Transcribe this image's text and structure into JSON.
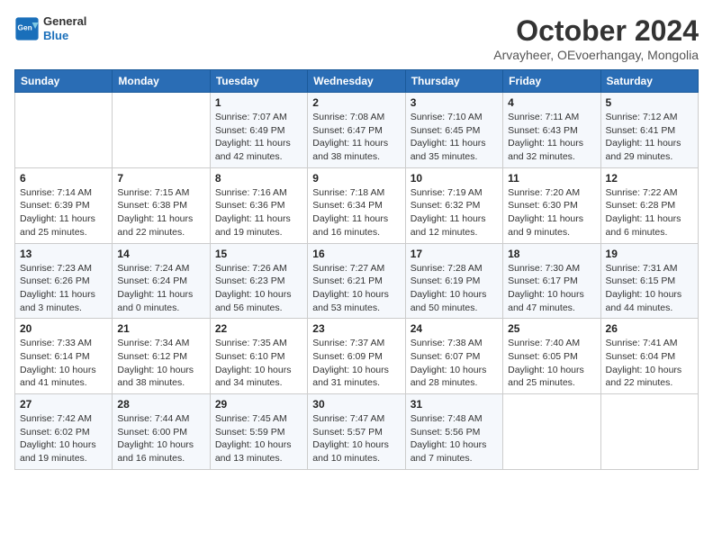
{
  "header": {
    "logo_line1": "General",
    "logo_line2": "Blue",
    "month": "October 2024",
    "location": "Arvayheer, OEvoerhangay, Mongolia"
  },
  "days_of_week": [
    "Sunday",
    "Monday",
    "Tuesday",
    "Wednesday",
    "Thursday",
    "Friday",
    "Saturday"
  ],
  "weeks": [
    [
      {
        "day": null
      },
      {
        "day": null
      },
      {
        "day": "1",
        "sunrise": "Sunrise: 7:07 AM",
        "sunset": "Sunset: 6:49 PM",
        "daylight": "Daylight: 11 hours and 42 minutes."
      },
      {
        "day": "2",
        "sunrise": "Sunrise: 7:08 AM",
        "sunset": "Sunset: 6:47 PM",
        "daylight": "Daylight: 11 hours and 38 minutes."
      },
      {
        "day": "3",
        "sunrise": "Sunrise: 7:10 AM",
        "sunset": "Sunset: 6:45 PM",
        "daylight": "Daylight: 11 hours and 35 minutes."
      },
      {
        "day": "4",
        "sunrise": "Sunrise: 7:11 AM",
        "sunset": "Sunset: 6:43 PM",
        "daylight": "Daylight: 11 hours and 32 minutes."
      },
      {
        "day": "5",
        "sunrise": "Sunrise: 7:12 AM",
        "sunset": "Sunset: 6:41 PM",
        "daylight": "Daylight: 11 hours and 29 minutes."
      }
    ],
    [
      {
        "day": "6",
        "sunrise": "Sunrise: 7:14 AM",
        "sunset": "Sunset: 6:39 PM",
        "daylight": "Daylight: 11 hours and 25 minutes."
      },
      {
        "day": "7",
        "sunrise": "Sunrise: 7:15 AM",
        "sunset": "Sunset: 6:38 PM",
        "daylight": "Daylight: 11 hours and 22 minutes."
      },
      {
        "day": "8",
        "sunrise": "Sunrise: 7:16 AM",
        "sunset": "Sunset: 6:36 PM",
        "daylight": "Daylight: 11 hours and 19 minutes."
      },
      {
        "day": "9",
        "sunrise": "Sunrise: 7:18 AM",
        "sunset": "Sunset: 6:34 PM",
        "daylight": "Daylight: 11 hours and 16 minutes."
      },
      {
        "day": "10",
        "sunrise": "Sunrise: 7:19 AM",
        "sunset": "Sunset: 6:32 PM",
        "daylight": "Daylight: 11 hours and 12 minutes."
      },
      {
        "day": "11",
        "sunrise": "Sunrise: 7:20 AM",
        "sunset": "Sunset: 6:30 PM",
        "daylight": "Daylight: 11 hours and 9 minutes."
      },
      {
        "day": "12",
        "sunrise": "Sunrise: 7:22 AM",
        "sunset": "Sunset: 6:28 PM",
        "daylight": "Daylight: 11 hours and 6 minutes."
      }
    ],
    [
      {
        "day": "13",
        "sunrise": "Sunrise: 7:23 AM",
        "sunset": "Sunset: 6:26 PM",
        "daylight": "Daylight: 11 hours and 3 minutes."
      },
      {
        "day": "14",
        "sunrise": "Sunrise: 7:24 AM",
        "sunset": "Sunset: 6:24 PM",
        "daylight": "Daylight: 11 hours and 0 minutes."
      },
      {
        "day": "15",
        "sunrise": "Sunrise: 7:26 AM",
        "sunset": "Sunset: 6:23 PM",
        "daylight": "Daylight: 10 hours and 56 minutes."
      },
      {
        "day": "16",
        "sunrise": "Sunrise: 7:27 AM",
        "sunset": "Sunset: 6:21 PM",
        "daylight": "Daylight: 10 hours and 53 minutes."
      },
      {
        "day": "17",
        "sunrise": "Sunrise: 7:28 AM",
        "sunset": "Sunset: 6:19 PM",
        "daylight": "Daylight: 10 hours and 50 minutes."
      },
      {
        "day": "18",
        "sunrise": "Sunrise: 7:30 AM",
        "sunset": "Sunset: 6:17 PM",
        "daylight": "Daylight: 10 hours and 47 minutes."
      },
      {
        "day": "19",
        "sunrise": "Sunrise: 7:31 AM",
        "sunset": "Sunset: 6:15 PM",
        "daylight": "Daylight: 10 hours and 44 minutes."
      }
    ],
    [
      {
        "day": "20",
        "sunrise": "Sunrise: 7:33 AM",
        "sunset": "Sunset: 6:14 PM",
        "daylight": "Daylight: 10 hours and 41 minutes."
      },
      {
        "day": "21",
        "sunrise": "Sunrise: 7:34 AM",
        "sunset": "Sunset: 6:12 PM",
        "daylight": "Daylight: 10 hours and 38 minutes."
      },
      {
        "day": "22",
        "sunrise": "Sunrise: 7:35 AM",
        "sunset": "Sunset: 6:10 PM",
        "daylight": "Daylight: 10 hours and 34 minutes."
      },
      {
        "day": "23",
        "sunrise": "Sunrise: 7:37 AM",
        "sunset": "Sunset: 6:09 PM",
        "daylight": "Daylight: 10 hours and 31 minutes."
      },
      {
        "day": "24",
        "sunrise": "Sunrise: 7:38 AM",
        "sunset": "Sunset: 6:07 PM",
        "daylight": "Daylight: 10 hours and 28 minutes."
      },
      {
        "day": "25",
        "sunrise": "Sunrise: 7:40 AM",
        "sunset": "Sunset: 6:05 PM",
        "daylight": "Daylight: 10 hours and 25 minutes."
      },
      {
        "day": "26",
        "sunrise": "Sunrise: 7:41 AM",
        "sunset": "Sunset: 6:04 PM",
        "daylight": "Daylight: 10 hours and 22 minutes."
      }
    ],
    [
      {
        "day": "27",
        "sunrise": "Sunrise: 7:42 AM",
        "sunset": "Sunset: 6:02 PM",
        "daylight": "Daylight: 10 hours and 19 minutes."
      },
      {
        "day": "28",
        "sunrise": "Sunrise: 7:44 AM",
        "sunset": "Sunset: 6:00 PM",
        "daylight": "Daylight: 10 hours and 16 minutes."
      },
      {
        "day": "29",
        "sunrise": "Sunrise: 7:45 AM",
        "sunset": "Sunset: 5:59 PM",
        "daylight": "Daylight: 10 hours and 13 minutes."
      },
      {
        "day": "30",
        "sunrise": "Sunrise: 7:47 AM",
        "sunset": "Sunset: 5:57 PM",
        "daylight": "Daylight: 10 hours and 10 minutes."
      },
      {
        "day": "31",
        "sunrise": "Sunrise: 7:48 AM",
        "sunset": "Sunset: 5:56 PM",
        "daylight": "Daylight: 10 hours and 7 minutes."
      },
      {
        "day": null
      },
      {
        "day": null
      }
    ]
  ]
}
